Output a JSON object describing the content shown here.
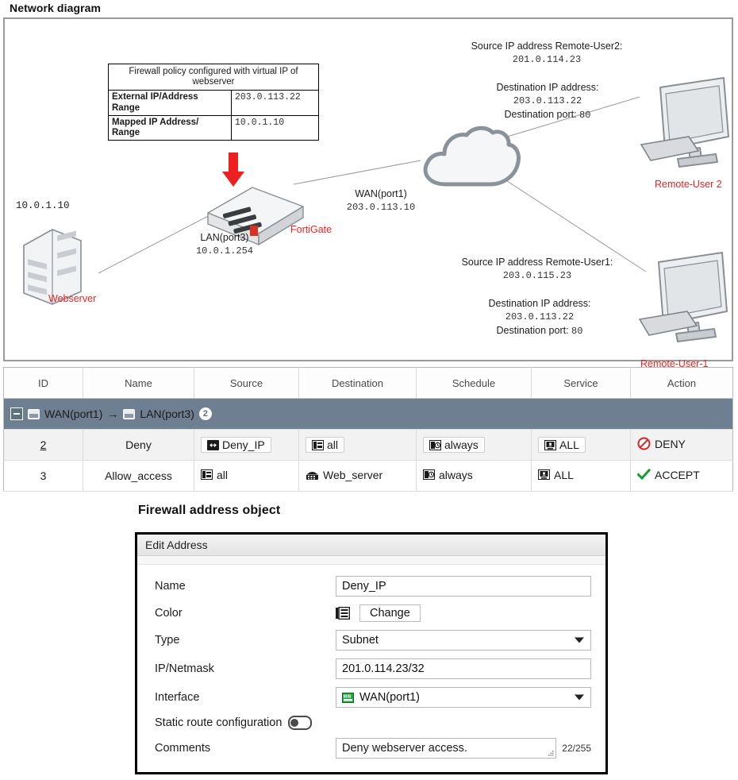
{
  "network_section": {
    "title": "Network diagram",
    "vip_table": {
      "header": "Firewall policy configured with virtual IP of webserver",
      "rows": [
        {
          "label": "External IP/Address Range",
          "value": "203.0.113.22"
        },
        {
          "label": "Mapped IP Address/ Range",
          "value": "10.0.1.10"
        }
      ]
    },
    "labels": {
      "webserver_ip": "10.0.1.10",
      "webserver_name": "Webserver",
      "lan_port": "LAN(port3)",
      "lan_ip": "10.0.1.254",
      "fortigate_name": "FortiGate",
      "wan_port": "WAN(port1)",
      "wan_ip": "203.0.113.10",
      "ru2_source_title": "Source IP address Remote-User2:",
      "ru2_source_ip": "201.0.114.23",
      "ru2_dest_title": "Destination IP address:",
      "ru2_dest_ip": "203.0.113.22",
      "ru2_dest_port_label": "Destination port:",
      "ru2_dest_port": "80",
      "ru1_source_title": "Source IP address Remote-User1:",
      "ru1_source_ip": "203.0.115.23",
      "ru1_dest_title": "Destination IP address:",
      "ru1_dest_ip": "203.0.113.22",
      "ru1_dest_port_label": "Destination port:",
      "ru1_dest_port": "80",
      "remote_user_2": "Remote-User 2",
      "remote_user_1": "Remote-User-1"
    },
    "icons": {
      "arrow": "red-down-arrow-icon",
      "cloud": "cloud-icon",
      "server": "server-rack-icon",
      "firewall": "fortigate-appliance-icon",
      "monitor": "desktop-monitor-icon"
    },
    "colors": {
      "accent_red": "#ee2222",
      "device_gray": "#8a8f96",
      "panel_border": "#9a9a9a"
    }
  },
  "policy_table": {
    "columns": [
      "ID",
      "Name",
      "Source",
      "Destination",
      "Schedule",
      "Service",
      "Action"
    ],
    "group_row": {
      "expander": "collapse-icon",
      "from_interface": "WAN(port1)",
      "arrow": "→",
      "to_interface": "LAN(port3)",
      "count": "2"
    },
    "rows": [
      {
        "id": "2",
        "name": "Deny",
        "source": "Deny_IP",
        "source_icon": "address-object-icon",
        "destination": "all",
        "destination_icon": "address-all-icon",
        "schedule": "always",
        "schedule_icon": "clock-icon",
        "service": "ALL",
        "service_icon": "service-icon",
        "action": "DENY",
        "action_icon": "deny-icon",
        "selected": true
      },
      {
        "id": "3",
        "name": "Allow_access",
        "source": "all",
        "source_icon": "address-all-icon",
        "destination": "Web_server",
        "destination_icon": "vip-server-icon",
        "schedule": "always",
        "schedule_icon": "clock-icon",
        "service": "ALL",
        "service_icon": "service-icon",
        "action": "ACCEPT",
        "action_icon": "accept-check-icon",
        "selected": false
      }
    ],
    "colors": {
      "group_bg": "#6d7f91",
      "deny": "#cc2222",
      "accept": "#179a2f"
    }
  },
  "address_object": {
    "section_title": "Firewall address object",
    "dialog_title": "Edit Address",
    "fields": {
      "name_label": "Name",
      "name_value": "Deny_IP",
      "color_label": "Color",
      "color_change_button": "Change",
      "type_label": "Type",
      "type_value": "Subnet",
      "ipnetmask_label": "IP/Netmask",
      "ipnetmask_value": "201.0.114.23/32",
      "interface_label": "Interface",
      "interface_value": "WAN(port1)",
      "static_route_label": "Static route configuration",
      "comments_label": "Comments",
      "comments_value": "Deny webserver access.",
      "comments_counter": "22/255"
    }
  }
}
